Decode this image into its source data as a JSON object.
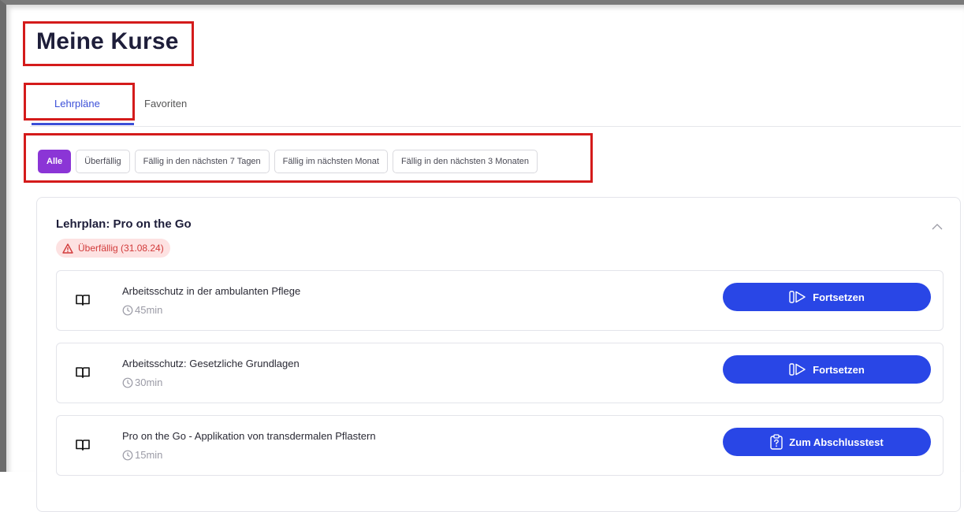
{
  "page": {
    "title": "Meine Kurse"
  },
  "tabs": [
    {
      "label": "Lehrpläne",
      "active": true
    },
    {
      "label": "Favoriten",
      "active": false
    }
  ],
  "filters": [
    {
      "label": "Alle",
      "active": true
    },
    {
      "label": "Überfällig",
      "active": false
    },
    {
      "label": "Fällig in den nächsten 7 Tagen",
      "active": false
    },
    {
      "label": "Fällig im nächsten Monat",
      "active": false
    },
    {
      "label": "Fällig in den nächsten 3 Monaten",
      "active": false
    }
  ],
  "curriculum": {
    "title": "Lehrplan: Pro on the Go",
    "status_badge": "Überfällig (31.08.24)",
    "status_icon": "warning-triangle-icon",
    "collapse_icon": "chevron-up-icon",
    "courses": [
      {
        "title": "Arbeitsschutz in der ambulanten Pflege",
        "duration": "45min",
        "button_label": "Fortsetzen",
        "button_icon": "resume-play-icon"
      },
      {
        "title": "Arbeitsschutz: Gesetzliche Grundlagen",
        "duration": "30min",
        "button_label": "Fortsetzen",
        "button_icon": "resume-play-icon"
      },
      {
        "title": "Pro on the Go - Applikation von transdermalen Pflastern",
        "duration": "15min",
        "button_label": "Zum Abschlusstest",
        "button_icon": "clipboard-question-icon"
      }
    ]
  },
  "colors": {
    "accent_blue": "#2946e6",
    "tab_active": "#3b4fd8",
    "filter_active": "#8b35d6",
    "overdue_bg": "#fde2e2",
    "overdue_text": "#d23a3a",
    "highlight_box": "#d41b1b"
  }
}
